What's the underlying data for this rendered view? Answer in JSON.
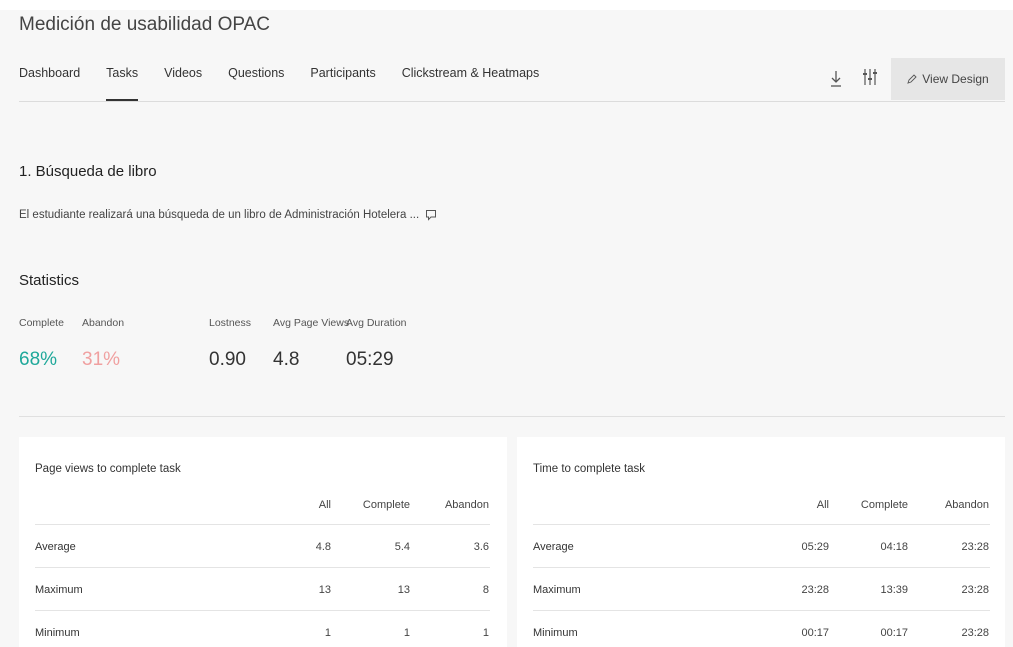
{
  "header": {
    "title": "Medición de usabilidad OPAC",
    "tabs": [
      {
        "label": "Dashboard"
      },
      {
        "label": "Tasks"
      },
      {
        "label": "Videos"
      },
      {
        "label": "Questions"
      },
      {
        "label": "Participants"
      },
      {
        "label": "Clickstream & Heatmaps"
      }
    ],
    "active_tab": "Tasks",
    "view_design_label": "View Design"
  },
  "task": {
    "title": "1. Búsqueda de libro",
    "description": "El estudiante realizará una búsqueda de un libro de Administración Hotelera ..."
  },
  "statistics": {
    "heading": "Statistics",
    "complete": {
      "label": "Complete",
      "value": "68%",
      "color": "#1fa89a"
    },
    "abandon": {
      "label": "Abandon",
      "value": "31%",
      "color": "#f0a0a0"
    },
    "lostness": {
      "label": "Lostness",
      "value": "0.90"
    },
    "avg_page_views": {
      "label": "Avg Page Views",
      "value": "4.8"
    },
    "avg_duration": {
      "label": "Avg Duration",
      "value": "05:29"
    }
  },
  "page_views_table": {
    "title": "Page views to complete task",
    "columns": [
      "All",
      "Complete",
      "Abandon"
    ],
    "rows": [
      {
        "label": "Average",
        "all": "4.8",
        "complete": "5.4",
        "abandon": "3.6"
      },
      {
        "label": "Maximum",
        "all": "13",
        "complete": "13",
        "abandon": "8"
      },
      {
        "label": "Minimum",
        "all": "1",
        "complete": "1",
        "abandon": "1"
      }
    ]
  },
  "time_table": {
    "title": "Time to complete task",
    "columns": [
      "All",
      "Complete",
      "Abandon"
    ],
    "rows": [
      {
        "label": "Average",
        "all": "05:29",
        "complete": "04:18",
        "abandon": "23:28"
      },
      {
        "label": "Maximum",
        "all": "23:28",
        "complete": "13:39",
        "abandon": "23:28"
      },
      {
        "label": "Minimum",
        "all": "00:17",
        "complete": "00:17",
        "abandon": "23:28"
      }
    ]
  }
}
